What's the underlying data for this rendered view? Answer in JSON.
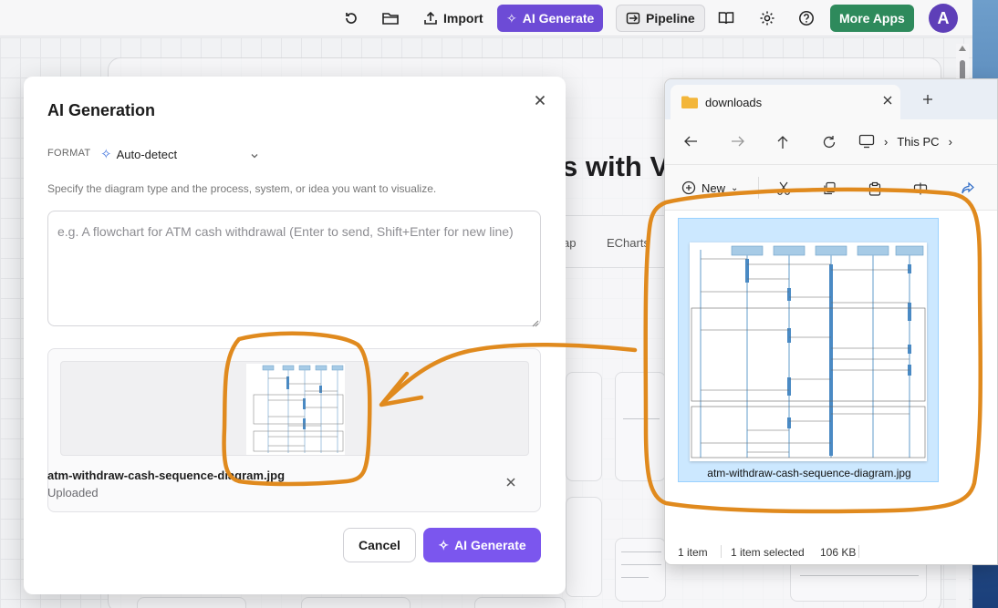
{
  "toolbar": {
    "import_label": "Import",
    "ai_generate_label": "AI Generate",
    "pipeline_label": "Pipeline",
    "more_apps_label": "More Apps",
    "avatar_initial": "A",
    "accent_color": "#6d4bd6",
    "more_apps_color": "#2e8a5c"
  },
  "background": {
    "hero_title": "s with VI",
    "tabs": [
      "ap",
      "ECharts"
    ]
  },
  "dialog": {
    "title": "AI Generation",
    "format_label": "FORMAT",
    "format_value": "Auto-detect",
    "helper_text": "Specify the diagram type and the process, system, or idea you want to visualize.",
    "prompt_placeholder": "e.g. A flowchart for ATM cash withdrawal (Enter to send, Shift+Enter for new line)",
    "prompt_value": "",
    "attachment": {
      "file_name": "atm-withdraw-cash-sequence-diagram.jpg",
      "status": "Uploaded"
    },
    "cancel_label": "Cancel",
    "generate_label": "AI Generate",
    "generate_color": "#7b56ee"
  },
  "explorer": {
    "tab_title": "downloads",
    "breadcrumb": [
      "This PC"
    ],
    "new_label": "New",
    "file": {
      "name": "atm-withdraw-cash-sequence-diagram.jpg"
    },
    "status": {
      "item_count": "1 item",
      "selection": "1 item selected",
      "size": "106 KB"
    }
  },
  "annotation_color": "#e08a1e"
}
